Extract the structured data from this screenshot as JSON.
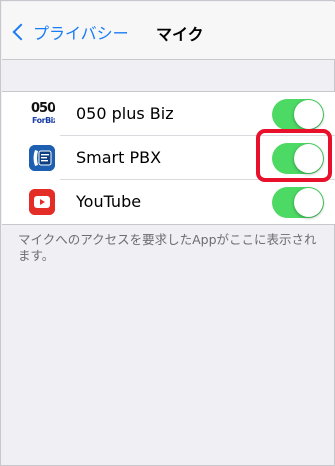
{
  "nav": {
    "back_label": "プライバシー",
    "title": "マイク"
  },
  "apps": [
    {
      "name": "050 plus Biz",
      "icon": "050-plus-biz-app-icon",
      "enabled": true
    },
    {
      "name": "Smart PBX",
      "icon": "smart-pbx-app-icon",
      "enabled": true
    },
    {
      "name": "YouTube",
      "icon": "youtube-app-icon",
      "enabled": true
    }
  ],
  "icon_text": {
    "plus_biz_top": "050",
    "plus_biz_bottom": "ForBiz"
  },
  "footer_note": "マイクへのアクセスを要求したAppがここに表示されます。",
  "colors": {
    "accent": "#1a7cf5",
    "toggle_on": "#4cd964",
    "highlight": "#e8102a"
  }
}
